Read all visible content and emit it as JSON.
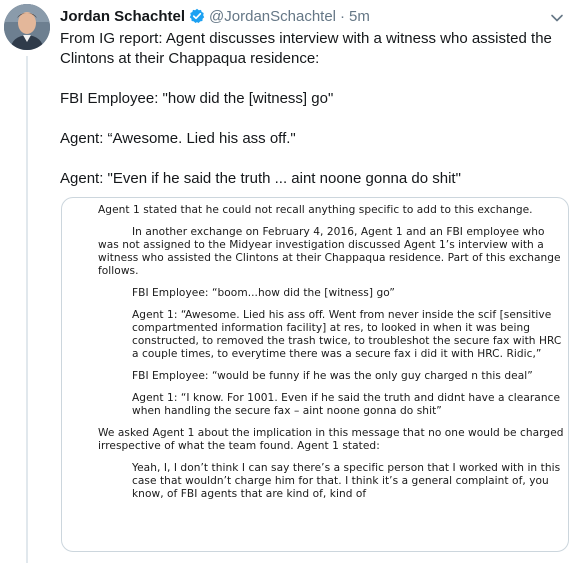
{
  "author": {
    "display_name": "Jordan Schachtel",
    "handle": "@JordanSchachtel",
    "separator": "·",
    "timestamp": "5m",
    "verified": true
  },
  "tweet": {
    "lines": [
      "From IG report: Agent discusses interview with a witness who assisted the Clintons at their Chappaqua residence:",
      "FBI Employee: \"how did the [witness] go\"",
      "Agent: “Awesome. Lied his ass off.\"",
      "Agent: \"Even if he said the truth ... aint noone gonna do shit\""
    ]
  },
  "document": {
    "paragraphs": [
      "Agent 1 stated that he could not recall anything specific to add to this exchange.",
      "In another exchange on February 4, 2016, Agent 1 and an FBI employee who was not assigned to the Midyear investigation discussed Agent 1’s interview with a witness who assisted the Clintons at their Chappaqua residence.  Part of this exchange follows.",
      "FBI Employee:  “boom...how did the [witness] go”",
      "Agent 1:  “Awesome.  Lied his ass off.  Went from never inside the scif [sensitive compartmented information facility] at res, to looked in when it was being constructed, to removed the trash twice, to troubleshot the secure fax with HRC a couple times, to everytime there was a secure fax i did it with HRC.  Ridic,”",
      "FBI Employee:  “would be funny if he was the only guy charged n this deal”",
      "Agent 1:  “I know.  For 1001.  Even if he said the truth and didnt have a clearance when handling the secure fax – aint noone gonna do shit”",
      "We asked Agent 1 about the implication in this message that no one would be charged irrespective of what the team found.  Agent 1 stated:",
      "Yeah, I, I don’t think I can say there’s a specific person that I worked with in this case that wouldn’t charge him for that.  I think it’s a general complaint of, you know, of FBI agents that are kind of, kind of"
    ]
  },
  "icons": {
    "verified": "verified-badge-icon",
    "more": "chevron-down-icon"
  },
  "colors": {
    "name": "#14171a",
    "secondary": "#657786",
    "verified": "#1da1f2",
    "border": "#ccd6dd"
  }
}
